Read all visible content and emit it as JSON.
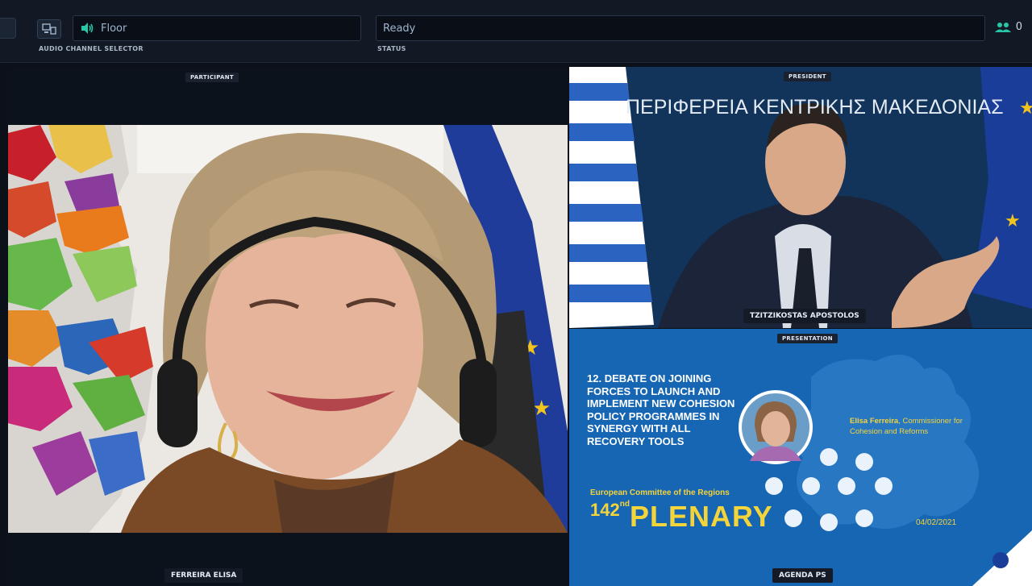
{
  "topbar": {
    "audio_caption": "AUDIO CHANNEL SELECTOR",
    "audio_channel": "Floor",
    "status_caption": "STATUS",
    "status_value": "Ready",
    "participant_count": "0"
  },
  "panels": {
    "participant_tag": "PARTICIPANT",
    "participant_name": "FERREIRA ELISA",
    "president_tag": "PRESIDENT",
    "president_name": "TZITZIKOSTAS APOSTOLOS",
    "president_backdrop": "ΠΕΡΙΦΕΡΕΙΑ ΚΕΝΤΡΙΚΗΣ ΜΑΚΕΔΟΝΙΑΣ",
    "presentation_tag": "PRESENTATION",
    "presentation_name": "AGENDA PS"
  },
  "presentation": {
    "item_number": "12.",
    "item_title": "DEBATE ON JOINING FORCES TO LAUNCH AND IMPLEMENT NEW COHESION POLICY PROGRAMMES IN SYNERGY WITH ALL RECOVERY TOOLS",
    "committee": "European Committee of the Regions",
    "plenary_number": "142",
    "plenary_suffix": "nd",
    "plenary_word": "PLENARY",
    "speaker_name": "Elisa Ferreira",
    "speaker_role": ", Commissioner for Cohesion and Reforms",
    "date": "04/02/2021"
  },
  "colors": {
    "topbar_bg": "#121925",
    "presentation_bg": "#1766b3",
    "accent_yellow": "#f4d43b"
  },
  "icons": {
    "device": "device-selector-icon",
    "speaker": "speaker-icon",
    "participants": "participants-icon"
  }
}
